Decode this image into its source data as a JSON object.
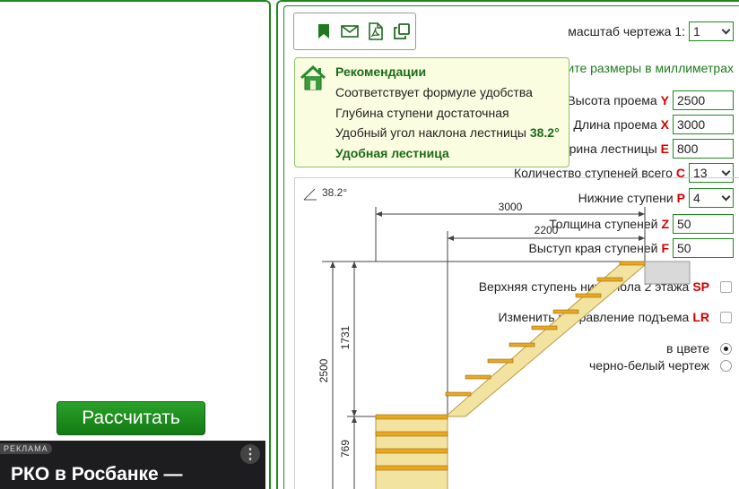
{
  "scale": {
    "label": "масштаб чертежа 1:",
    "value": "1"
  },
  "hint": "Укажите размеры в миллиметрах",
  "fields": {
    "height": {
      "label": "Высота проема",
      "letter": "Y",
      "value": "2500"
    },
    "length": {
      "label": "Длина проема",
      "letter": "X",
      "value": "3000"
    },
    "width": {
      "label": "Ширина лестницы",
      "letter": "E",
      "value": "800"
    },
    "steps_total": {
      "label": "Количество ступеней всего",
      "letter": "C",
      "value": "13"
    },
    "lower_steps": {
      "label": "Нижние ступени",
      "letter": "P",
      "value": "4"
    },
    "thickness": {
      "label": "Толщина ступеней",
      "letter": "Z",
      "value": "50"
    },
    "overhang": {
      "label": "Выступ края ступеней",
      "letter": "F",
      "value": "50"
    }
  },
  "options": {
    "top_step": {
      "label": "Верхняя ступень ниже пола 2 этажа",
      "letter": "SP",
      "checked": false
    },
    "direction": {
      "label": "Изменить направление подъема",
      "letter": "LR",
      "checked": false
    },
    "color": {
      "label": "в цвете",
      "selected": true
    },
    "bw": {
      "label": "черно-белый чертеж",
      "selected": false
    }
  },
  "calculate_label": "Рассчитать",
  "ad": {
    "tag": "РЕКЛАМА",
    "title": "РКО в Росбанке —"
  },
  "toolbar": {
    "icons": [
      "bookmark-icon",
      "mail-icon",
      "pdf-icon",
      "copy-icon"
    ]
  },
  "recommendations": {
    "title": "Рекомендации",
    "line1": "Соответствует формуле удобства",
    "line2": "Глубина ступени достаточная",
    "line3_prefix": "Удобный угол наклона лестницы",
    "angle": "38.2°",
    "verdict": "Удобная лестница"
  },
  "drawing": {
    "angle_label": "38.2°",
    "dim_total_length": "3000",
    "dim_upper_length": "2200",
    "dim_total_height": "2500",
    "dim_upper_height": "1731",
    "dim_lower_height": "769",
    "colors": {
      "wood": "#f3e3a0",
      "step": "#e9a820",
      "floor": "#d9d9d9"
    }
  }
}
